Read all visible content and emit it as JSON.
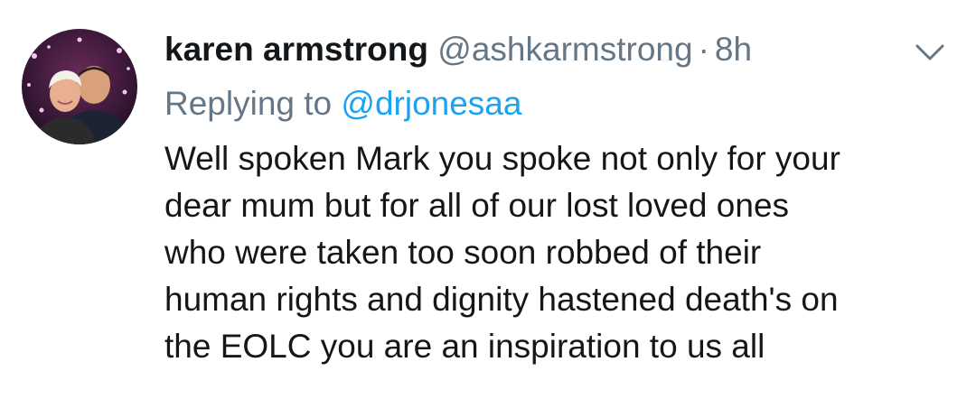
{
  "tweet": {
    "author_name": "karen armstrong",
    "author_handle": "@ashkarmstrong",
    "separator": "·",
    "timestamp": "8h",
    "replying_prefix": "Replying to",
    "replying_to": "@drjonesaa",
    "body_lines": [
      "Well spoken Mark you spoke not only for your",
      "dear mum but for all of our lost loved ones",
      "who were taken too soon robbed of their",
      "human rights and dignity hastened death's on",
      "the EOLC you are an inspiration to us all"
    ]
  },
  "icons": {
    "menu": "chevron-down-icon",
    "avatar": "profile-photo"
  },
  "colors": {
    "text_primary": "#14171a",
    "text_secondary": "#657786",
    "link": "#1da1f2",
    "background": "#ffffff"
  }
}
